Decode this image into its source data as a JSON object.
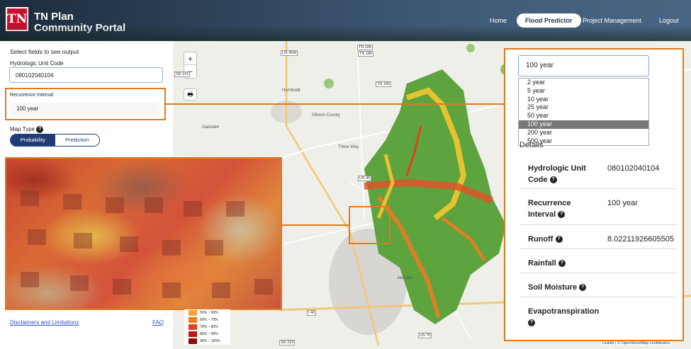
{
  "header": {
    "logo_text": "TN",
    "brand_line1": "TN Plan",
    "brand_line2": "Community Portal",
    "nav": [
      "Home",
      "Flood Predictor",
      "Project Management",
      "Logout"
    ],
    "active_nav": "Flood Predictor"
  },
  "left_panel": {
    "instructions": "Select fields to see output",
    "huc_label": "Hydrologic Unit Code",
    "huc_value": "080102040104",
    "ri_label": "Recurrence Interval",
    "ri_value": "100 year",
    "map_type_label": "Map Type",
    "map_type_options": [
      "Probability",
      "Prediction"
    ],
    "map_type_selected": "Probability",
    "disclaimer_link": "Disclaimers and Limitations",
    "faq_link": "FAQ"
  },
  "map": {
    "zoom_in": "+",
    "zoom_out": "−",
    "print_icon": "🖶",
    "road_labels": [
      "US 45W",
      "TN 186",
      "TN 186",
      "SR 152",
      "US 45",
      "I 40",
      "US 70",
      "SR 223",
      "TN 186"
    ],
    "towns": [
      "Humboldt",
      "Gibson County",
      "Gadsden",
      "Three Way",
      "Jackson"
    ],
    "attribution": "Leaflet | © OpenStreetMap contributors"
  },
  "legend": [
    {
      "label": "50% ~ 60%",
      "color": "#f6a33a"
    },
    {
      "label": "60% ~ 70%",
      "color": "#f07a22"
    },
    {
      "label": "70% ~ 80%",
      "color": "#e0421d"
    },
    {
      "label": "80% ~ 90%",
      "color": "#c41414"
    },
    {
      "label": "90% ~ 100%",
      "color": "#8c0a0a"
    }
  ],
  "dropdown": {
    "selected": "100 year",
    "options": [
      "2 year",
      "5 year",
      "10 year",
      "25 year",
      "50 year",
      "100 year",
      "200 year",
      "500 year"
    ]
  },
  "details": {
    "title": "Details",
    "rows": [
      {
        "key": "Hydrologic Unit Code",
        "value": "080102040104"
      },
      {
        "key": "Recurrence Interval",
        "value": "100 year"
      },
      {
        "key": "Runoff",
        "value": "8.02211926605505"
      },
      {
        "key": "Rainfall",
        "value": ""
      },
      {
        "key": "Soil Moisture",
        "value": ""
      },
      {
        "key": "Evapotranspiration",
        "value": ""
      }
    ]
  },
  "colors": {
    "highlight": "#e07a1f",
    "nav_active_text": "#1e3650",
    "toggle_blue": "#1f3d74",
    "link_blue": "#2a56c6"
  }
}
